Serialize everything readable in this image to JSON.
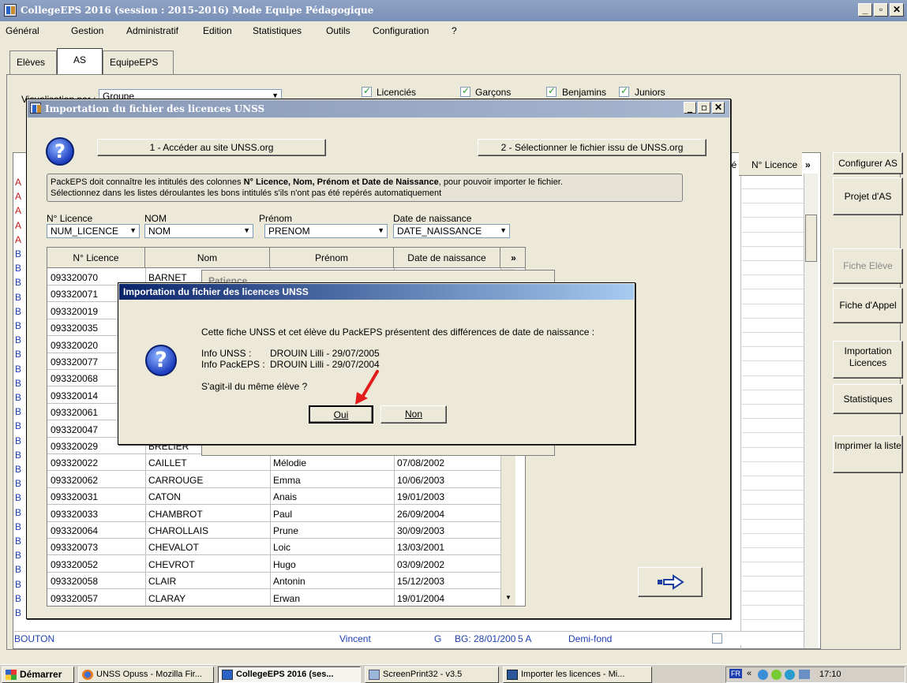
{
  "app": {
    "title": "CollegeEPS 2016 (session : 2015-2016) Mode Equipe Pédagogique"
  },
  "menu": [
    "Général",
    "Gestion",
    "Administratif",
    "Edition",
    "Statistiques",
    "Outils",
    "Configuration",
    "?"
  ],
  "tabs": [
    {
      "label": "Elèves"
    },
    {
      "label": "AS",
      "active": true
    },
    {
      "label": "EquipeEPS"
    }
  ],
  "filters": {
    "visualisation_label": "Visualisation par :",
    "visualisation_value": "Groupe",
    "licencies": "Licenciés",
    "garcons": "Garçons",
    "benjamins": "Benjamins",
    "juniors": "Juniors"
  },
  "background_grid": {
    "col_partial": "ié",
    "col_licence": "N° Licence",
    "more": "»",
    "row_prefixes": [
      "A",
      "A",
      "A",
      "A",
      "A",
      "B",
      "B",
      "B",
      "B",
      "B",
      "B",
      "B",
      "B",
      "B",
      "B",
      "B",
      "B",
      "B",
      "B",
      "B",
      "B",
      "B",
      "B",
      "B",
      "B",
      "B",
      "B",
      "B",
      "B",
      "B",
      "B"
    ],
    "last_row": {
      "nom": "BOUTON",
      "prenom": "Vincent",
      "sexe": "G",
      "cat_date": "BG: 28/01/200",
      "classe": "5 A",
      "activite": "Demi-fond"
    }
  },
  "right_buttons": [
    {
      "label": "Configurer AS",
      "disabled": false
    },
    {
      "label": "Projet d'AS",
      "disabled": false
    },
    {
      "label": "Fiche Elève",
      "disabled": true
    },
    {
      "label": "Fiche d'Appel",
      "disabled": false
    },
    {
      "label": "Importation Licences",
      "disabled": false
    },
    {
      "label": "Statistiques",
      "disabled": false
    },
    {
      "label": "Imprimer la liste",
      "disabled": false
    }
  ],
  "import_window": {
    "title": "Importation du fichier des licences UNSS",
    "btn_site": "1 - Accéder au site UNSS.org",
    "btn_file": "2 - Sélectionner le fichier issu de UNSS.org",
    "info_line1_pre": "PackEPS doit connaître les intitulés des colonnes ",
    "info_line1_bold": "N° Licence, Nom, Prénom et Date de Naissance",
    "info_line1_post": ",  pour pouvoir importer le fichier.",
    "info_line2": "Sélectionnez dans les listes déroulantes les bons intitulés s'ils n'ont pas été repérés automatiquement",
    "mapping": [
      {
        "label": "N° Licence",
        "value": "NUM_LICENCE"
      },
      {
        "label": "NOM",
        "value": "NOM"
      },
      {
        "label": "Prénom",
        "value": "PRENOM"
      },
      {
        "label": "Date de naissance",
        "value": "DATE_NAISSANCE"
      }
    ],
    "grid_headers": [
      "N° Licence",
      "Nom",
      "Prénom",
      "Date de naissance",
      "»"
    ],
    "rows": [
      {
        "licence": "093320070",
        "nom": "BARNET",
        "prenom": "",
        "date": ""
      },
      {
        "licence": "093320071",
        "nom": "",
        "prenom": "",
        "date": ""
      },
      {
        "licence": "093320019",
        "nom": "",
        "prenom": "",
        "date": ""
      },
      {
        "licence": "093320035",
        "nom": "",
        "prenom": "",
        "date": ""
      },
      {
        "licence": "093320020",
        "nom": "",
        "prenom": "",
        "date": ""
      },
      {
        "licence": "093320077",
        "nom": "",
        "prenom": "",
        "date": ""
      },
      {
        "licence": "093320068",
        "nom": "",
        "prenom": "",
        "date": ""
      },
      {
        "licence": "093320014",
        "nom": "",
        "prenom": "",
        "date": ""
      },
      {
        "licence": "093320061",
        "nom": "",
        "prenom": "",
        "date": ""
      },
      {
        "licence": "093320047",
        "nom": "",
        "prenom": "",
        "date": ""
      },
      {
        "licence": "093320029",
        "nom": "BRELIER",
        "prenom": "",
        "date": ""
      },
      {
        "licence": "093320022",
        "nom": "CAILLET",
        "prenom": "Mélodie",
        "date": "07/08/2002"
      },
      {
        "licence": "093320062",
        "nom": "CARROUGE",
        "prenom": "Emma",
        "date": "10/06/2003"
      },
      {
        "licence": "093320031",
        "nom": "CATON",
        "prenom": "Anais",
        "date": "19/01/2003"
      },
      {
        "licence": "093320033",
        "nom": "CHAMBROT",
        "prenom": "Paul",
        "date": "26/09/2004"
      },
      {
        "licence": "093320064",
        "nom": "CHAROLLAIS",
        "prenom": "Prune",
        "date": "30/09/2003"
      },
      {
        "licence": "093320073",
        "nom": "CHEVALOT",
        "prenom": "Loic",
        "date": "13/03/2001"
      },
      {
        "licence": "093320052",
        "nom": "CHEVROT",
        "prenom": "Hugo",
        "date": "03/09/2002"
      },
      {
        "licence": "093320058",
        "nom": "CLAIR",
        "prenom": "Antonin",
        "date": "15/12/2003"
      },
      {
        "licence": "093320057",
        "nom": "CLARAY",
        "prenom": "Erwan",
        "date": "19/01/2004"
      }
    ],
    "behind_popup_text": "Patience..."
  },
  "dialog": {
    "title": "Importation du fichier des licences UNSS",
    "line1": "Cette fiche UNSS et cet élève du PackEPS  présentent des différences de date de naissance :",
    "unss_label": "Info UNSS :",
    "unss_value": "DROUIN Lilli - 29/07/2005",
    "packeps_label": "Info PackEPS :",
    "packeps_value": "DROUIN Lilli - 29/07/2004",
    "question": "S'agit-il du même élève ?",
    "btn_oui": "Oui",
    "btn_non": "Non"
  },
  "taskbar": {
    "start": "Démarrer",
    "items": [
      {
        "label": "UNSS Opuss - Mozilla Fir...",
        "active": false
      },
      {
        "label": "CollegeEPS 2016 (ses...",
        "active": true
      },
      {
        "label": "ScreenPrint32 - v3.5",
        "active": false
      },
      {
        "label": "Importer les licences - Mi...",
        "active": false
      }
    ],
    "lang": "FR",
    "clock": "17:10"
  },
  "colors": {
    "accent": "#0a246a",
    "arrow_red": "#e21b1b",
    "arrow_blue": "#1f3fa0"
  }
}
